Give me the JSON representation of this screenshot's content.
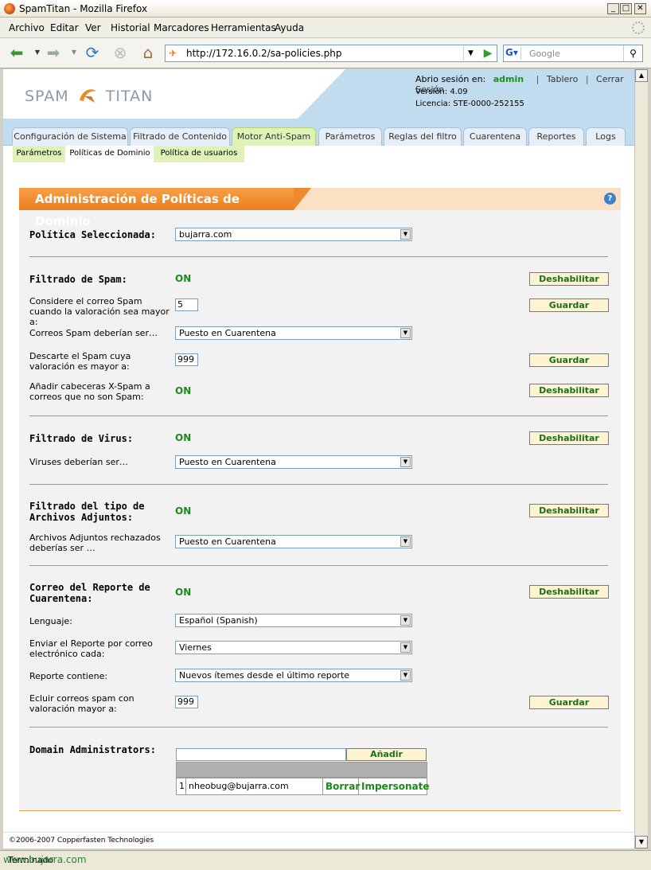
{
  "window": {
    "title": "SpamTitan - Mozilla Firefox"
  },
  "menu": [
    "Archivo",
    "Editar",
    "Ver",
    "Historial",
    "Marcadores",
    "Herramientas",
    "Ayuda"
  ],
  "nav": {
    "url": "http://172.16.0.2/sa-policies.php",
    "search_placeholder": "Google"
  },
  "header": {
    "logo_left": "SPAM",
    "logo_right": "TITAN",
    "session_label": "Abrio sesión en:",
    "user": "admin",
    "dashboard": "Tablero",
    "logout": "Cerrar Sesión",
    "version": "Versión: 4.09",
    "license": "Licencia: STE-0000-252155"
  },
  "tabs": [
    "Configuración de Sistema",
    "Filtrado de Contenido",
    "Motor Anti-Spam",
    "Parámetros",
    "Reglas del filtro",
    "Cuarentena",
    "Reportes",
    "Logs"
  ],
  "subtabs": [
    "Parámetros",
    "Políticas de Dominio",
    "Política de usuarios"
  ],
  "panel": {
    "title": "Administración de Políticas de Dominio",
    "help": "?",
    "policy_label": "Política Seleccionada:",
    "policy_value": "bujarra.com",
    "spam": {
      "label": "Filtrado de Spam:",
      "status": "ON",
      "disable": "Deshabilitar",
      "threshold_label": "Considere el correo Spam cuando la valoración sea mayor a:",
      "threshold_value": "5",
      "save": "Guardar",
      "action_label": "Correos Spam deberían ser…",
      "action_value": "Puesto en Cuarentena",
      "discard_label": "Descarte el Spam cuya valoración es mayor a:",
      "discard_value": "999",
      "headers_label": "Añadir cabeceras X-Spam a correos que no son Spam:",
      "headers_status": "ON"
    },
    "virus": {
      "label": "Filtrado de Virus:",
      "status": "ON",
      "disable": "Deshabilitar",
      "action_label": "Viruses deberían ser…",
      "action_value": "Puesto en Cuarentena"
    },
    "attach": {
      "label1": "Filtrado del tipo de",
      "label2": "Archivos Adjuntos:",
      "status": "ON",
      "disable": "Deshabilitar",
      "action_label": "Archivos Adjuntos rechazados deberías ser …",
      "action_value": "Puesto en Cuarentena"
    },
    "report": {
      "label1": "Correo del Reporte de",
      "label2": "Cuarentena:",
      "status": "ON",
      "disable": "Deshabilitar",
      "lang_label": "Lenguaje:",
      "lang_value": "Español (Spanish)",
      "send_label": "Enviar el Reporte por correo electrónico cada:",
      "send_value": "Viernes",
      "contains_label": "Reporte contiene:",
      "contains_value": "Nuevos ítemes desde el último reporte",
      "exclude_label": "Ecluir correos spam con valoración mayor a:",
      "exclude_value": "999",
      "save": "Guardar"
    },
    "admins": {
      "label": "Domain Administrators:",
      "add": "Añadir",
      "rows": [
        {
          "num": "1",
          "email": "nheobug@bujarra.com",
          "delete": "Borrar",
          "impersonate": "Impersonate"
        }
      ]
    }
  },
  "footer": "©2006-2007 Copperfasten Technologies",
  "status": "Terminado",
  "watermark": "www.bujarra.com"
}
